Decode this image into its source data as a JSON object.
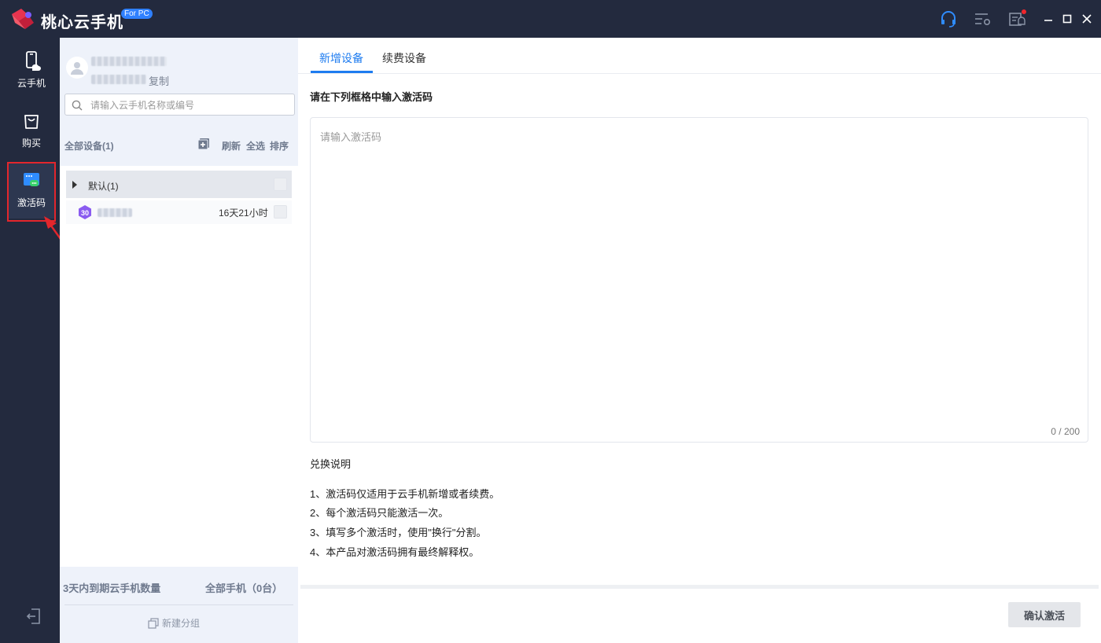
{
  "titlebar": {
    "app_title": "桃心云手机",
    "badge": "For PC",
    "icons": [
      "headset-icon",
      "settings-icon",
      "notification-icon",
      "minimize-icon",
      "maximize-icon",
      "close-icon"
    ]
  },
  "nav": {
    "items": [
      {
        "label": "云手机",
        "icon": "phone-icon"
      },
      {
        "label": "购买",
        "icon": "shopping-bag-icon"
      },
      {
        "label": "激活码",
        "icon": "activation-code-icon",
        "active": true
      }
    ],
    "logout_icon": "logout-icon"
  },
  "sidebar": {
    "copy_label": "复制",
    "search_placeholder": "请输入云手机名称或编号",
    "devices_header": "全部设备(1)",
    "actions": {
      "refresh": "刷新",
      "select_all": "全选",
      "sort": "排序"
    },
    "group": {
      "label": "默认(1)"
    },
    "device": {
      "badge": "30",
      "time_left": "16天21小时"
    },
    "expiring_label": "3天内到期云手机数量",
    "all_phones_label": "全部手机（0台）",
    "new_group": "新建分组"
  },
  "content": {
    "tabs": [
      {
        "label": "新增设备",
        "active": true
      },
      {
        "label": "续费设备"
      }
    ],
    "instruction": "请在下列框格中输入激活码",
    "code_placeholder": "请输入激活码",
    "char_count": "0 / 200",
    "notes_title": "兑换说明",
    "notes": [
      "1、激活码仅适用于云手机新增或者续费。",
      "2、每个激活码只能激活一次。",
      "3、填写多个激活时，使用\"换行\"分割。",
      "4、本产品对激活码拥有最终解释权。"
    ],
    "confirm_button": "确认激活"
  },
  "colors": {
    "titlebar_bg": "#232a3e",
    "accent": "#1e7cf0",
    "highlight_red": "#e3262c"
  }
}
